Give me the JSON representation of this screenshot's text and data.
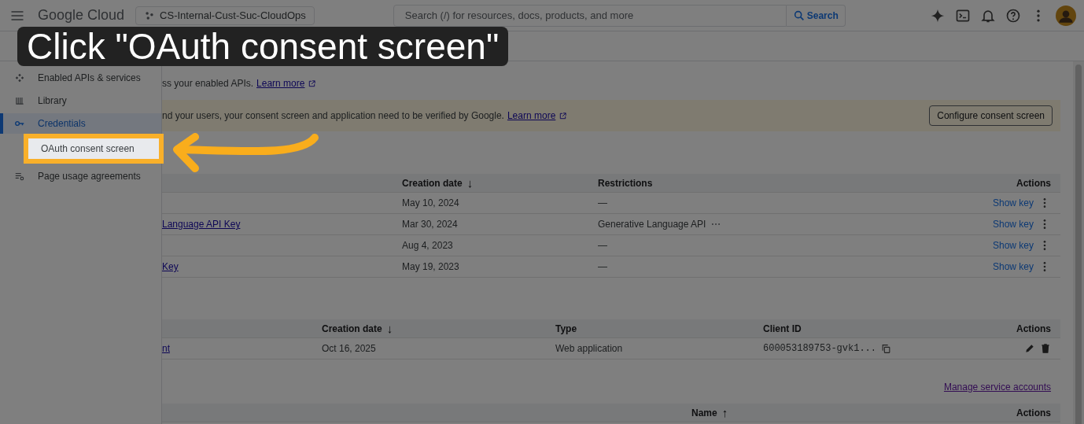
{
  "header": {
    "logo": "Google Cloud",
    "project": "CS-Internal-Cust-Suc-CloudOps",
    "search": {
      "placeholder": "Search (/) for resources, docs, products, and more"
    },
    "search_button": "Search"
  },
  "sidebar": {
    "items": [
      {
        "label": "Enabled APIs & services",
        "kind": "api",
        "selected": false,
        "highlighted": false
      },
      {
        "label": "Library",
        "kind": "library",
        "selected": false,
        "highlighted": false
      },
      {
        "label": "Credentials",
        "kind": "key",
        "selected": true,
        "highlighted": false
      },
      {
        "label": "OAuth consent screen",
        "kind": "consent",
        "selected": false,
        "highlighted": true
      },
      {
        "label": "Page usage agreements",
        "kind": "agreements",
        "selected": false,
        "highlighted": false
      }
    ]
  },
  "callout": {
    "text": "Click \"OAuth consent screen\""
  },
  "info": {
    "text": "ss your enabled APIs.",
    "link": "Learn more"
  },
  "notice": {
    "text": "nd your users, your consent screen and application need to be verified by Google.",
    "link": "Learn more",
    "button": "Configure consent screen"
  },
  "api_keys": {
    "columns": [
      {
        "label": "Creation date",
        "sort": "↓"
      },
      {
        "label": "Restrictions"
      },
      {
        "label": "Actions"
      }
    ],
    "rows": [
      {
        "created": "May 10, 2024",
        "restrictions": "—",
        "more_restrictions": false,
        "action": "Show key"
      },
      {
        "name": "Language API Key",
        "created": "Mar 30, 2024",
        "restrictions": "Generative Language API",
        "more_restrictions": true,
        "action": "Show key"
      },
      {
        "created": "Aug 4, 2023",
        "restrictions": "—",
        "more_restrictions": false,
        "action": "Show key"
      },
      {
        "name": "Key",
        "created": "May 19, 2023",
        "restrictions": "—",
        "more_restrictions": false,
        "action": "Show key"
      }
    ]
  },
  "oauth_clients": {
    "columns": [
      {
        "label": "Creation date",
        "sort": "↓"
      },
      {
        "label": "Type"
      },
      {
        "label": "Client ID"
      },
      {
        "label": "Actions"
      }
    ],
    "rows": [
      {
        "name": "nt",
        "created": "Oct 16, 2025",
        "type": "Web application",
        "client_id": "600053189753-gvk1..."
      }
    ]
  },
  "service_accounts": {
    "link": "Manage service accounts",
    "columns": [
      {
        "label": "Name",
        "sort": "↑"
      },
      {
        "label": "Actions"
      }
    ]
  }
}
